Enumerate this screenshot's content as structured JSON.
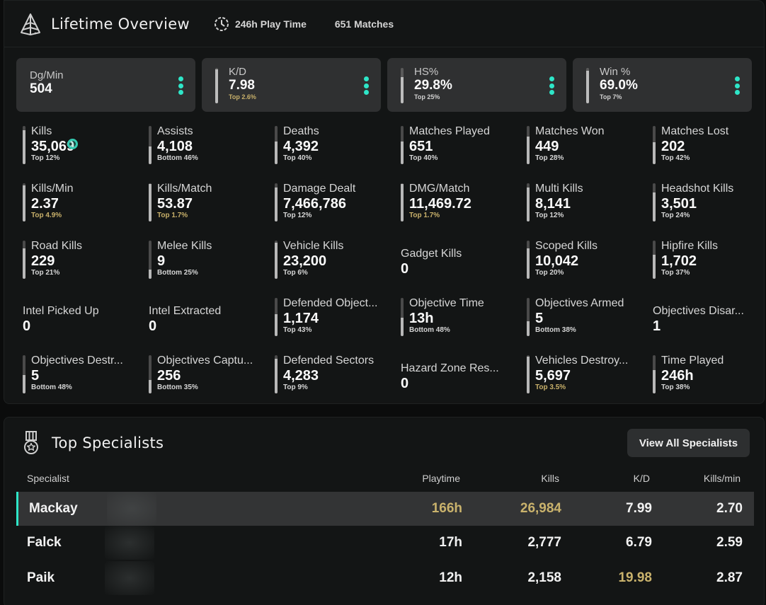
{
  "overview": {
    "title": "Lifetime Overview",
    "icon": "pyramid-icon",
    "play_time": "246h Play Time",
    "matches": "651 Matches",
    "accent_color": "#2ee6c8",
    "gold_color": "#c8b06a",
    "cards": [
      {
        "label": "Dg/Min",
        "value": "504",
        "sub": "",
        "has_bar": false,
        "percentile_fill": null,
        "gold": false
      },
      {
        "label": "K/D",
        "value": "7.98",
        "sub": "Top 2.6%",
        "has_bar": true,
        "percentile_fill": 0.97,
        "gold": true
      },
      {
        "label": "HS%",
        "value": "29.8%",
        "sub": "Top 25%",
        "has_bar": true,
        "percentile_fill": 0.75,
        "gold": false
      },
      {
        "label": "Win %",
        "value": "69.0%",
        "sub": "Top 7%",
        "has_bar": true,
        "percentile_fill": 0.93,
        "gold": false
      }
    ],
    "stats": [
      {
        "label": "Kills",
        "value": "35,069",
        "sub": "Top 12%",
        "has_bar": true,
        "percentile_fill": 0.88,
        "gold": false
      },
      {
        "label": "Assists",
        "value": "4,108",
        "sub": "Bottom 46%",
        "has_bar": true,
        "percentile_fill": 0.46,
        "gold": false
      },
      {
        "label": "Deaths",
        "value": "4,392",
        "sub": "Top 40%",
        "has_bar": true,
        "percentile_fill": 0.6,
        "gold": false
      },
      {
        "label": "Matches Played",
        "value": "651",
        "sub": "Top 40%",
        "has_bar": true,
        "percentile_fill": 0.6,
        "gold": false
      },
      {
        "label": "Matches Won",
        "value": "449",
        "sub": "Top 28%",
        "has_bar": true,
        "percentile_fill": 0.72,
        "gold": false
      },
      {
        "label": "Matches Lost",
        "value": "202",
        "sub": "Top 42%",
        "has_bar": true,
        "percentile_fill": 0.58,
        "gold": false
      },
      {
        "label": "Kills/Min",
        "value": "2.37",
        "sub": "Top 4.9%",
        "has_bar": true,
        "percentile_fill": 0.95,
        "gold": true
      },
      {
        "label": "Kills/Match",
        "value": "53.87",
        "sub": "Top 1.7%",
        "has_bar": true,
        "percentile_fill": 0.98,
        "gold": true
      },
      {
        "label": "Damage Dealt",
        "value": "7,466,786",
        "sub": "Top 12%",
        "has_bar": true,
        "percentile_fill": 0.88,
        "gold": false
      },
      {
        "label": "DMG/Match",
        "value": "11,469.72",
        "sub": "Top 1.7%",
        "has_bar": true,
        "percentile_fill": 0.98,
        "gold": true
      },
      {
        "label": "Multi Kills",
        "value": "8,141",
        "sub": "Top 12%",
        "has_bar": true,
        "percentile_fill": 0.88,
        "gold": false
      },
      {
        "label": "Headshot Kills",
        "value": "3,501",
        "sub": "Top 24%",
        "has_bar": true,
        "percentile_fill": 0.76,
        "gold": false
      },
      {
        "label": "Road Kills",
        "value": "229",
        "sub": "Top 21%",
        "has_bar": true,
        "percentile_fill": 0.79,
        "gold": false
      },
      {
        "label": "Melee Kills",
        "value": "9",
        "sub": "Bottom 25%",
        "has_bar": true,
        "percentile_fill": 0.25,
        "gold": false
      },
      {
        "label": "Vehicle Kills",
        "value": "23,200",
        "sub": "Top 6%",
        "has_bar": true,
        "percentile_fill": 0.94,
        "gold": false
      },
      {
        "label": "Gadget Kills",
        "value": "0",
        "sub": "",
        "has_bar": false,
        "percentile_fill": null,
        "gold": false
      },
      {
        "label": "Scoped Kills",
        "value": "10,042",
        "sub": "Top 20%",
        "has_bar": true,
        "percentile_fill": 0.8,
        "gold": false
      },
      {
        "label": "Hipfire Kills",
        "value": "1,702",
        "sub": "Top 37%",
        "has_bar": true,
        "percentile_fill": 0.63,
        "gold": false
      },
      {
        "label": "Intel Picked Up",
        "value": "0",
        "sub": "",
        "has_bar": false,
        "percentile_fill": null,
        "gold": false
      },
      {
        "label": "Intel Extracted",
        "value": "0",
        "sub": "",
        "has_bar": false,
        "percentile_fill": null,
        "gold": false
      },
      {
        "label": "Defended Object...",
        "value": "1,174",
        "sub": "Top 43%",
        "has_bar": true,
        "percentile_fill": 0.57,
        "gold": false
      },
      {
        "label": "Objective Time",
        "value": "13h",
        "sub": "Bottom 48%",
        "has_bar": true,
        "percentile_fill": 0.48,
        "gold": false
      },
      {
        "label": "Objectives Armed",
        "value": "5",
        "sub": "Bottom 38%",
        "has_bar": true,
        "percentile_fill": 0.38,
        "gold": false
      },
      {
        "label": "Objectives Disar...",
        "value": "1",
        "sub": "",
        "has_bar": false,
        "percentile_fill": null,
        "gold": false
      },
      {
        "label": "Objectives Destr...",
        "value": "5",
        "sub": "Bottom 48%",
        "has_bar": true,
        "percentile_fill": 0.48,
        "gold": false
      },
      {
        "label": "Objectives Captu...",
        "value": "256",
        "sub": "Bottom 35%",
        "has_bar": true,
        "percentile_fill": 0.35,
        "gold": false
      },
      {
        "label": "Defended Sectors",
        "value": "4,283",
        "sub": "Top 9%",
        "has_bar": true,
        "percentile_fill": 0.91,
        "gold": false
      },
      {
        "label": "Hazard Zone Res...",
        "value": "0",
        "sub": "",
        "has_bar": false,
        "percentile_fill": null,
        "gold": false
      },
      {
        "label": "Vehicles Destroy...",
        "value": "5,697",
        "sub": "Top 3.5%",
        "has_bar": true,
        "percentile_fill": 0.965,
        "gold": true
      },
      {
        "label": "Time Played",
        "value": "246h",
        "sub": "Top 38%",
        "has_bar": true,
        "percentile_fill": 0.62,
        "gold": false
      }
    ]
  },
  "specialists": {
    "title": "Top Specialists",
    "icon": "medal-icon",
    "view_all_label": "View All Specialists",
    "columns": [
      "Specialist",
      "Playtime",
      "Kills",
      "K/D",
      "Kills/min"
    ],
    "rows": [
      {
        "name": "Mackay",
        "playtime": "166h",
        "kills": "26,984",
        "kd": "7.99",
        "kpm": "2.70",
        "highlight": true,
        "gold": [
          "playtime",
          "kills"
        ]
      },
      {
        "name": "Falck",
        "playtime": "17h",
        "kills": "2,777",
        "kd": "6.79",
        "kpm": "2.59",
        "highlight": false,
        "gold": []
      },
      {
        "name": "Paik",
        "playtime": "12h",
        "kills": "2,158",
        "kd": "19.98",
        "kpm": "2.87",
        "highlight": false,
        "gold": [
          "kd"
        ]
      }
    ]
  }
}
